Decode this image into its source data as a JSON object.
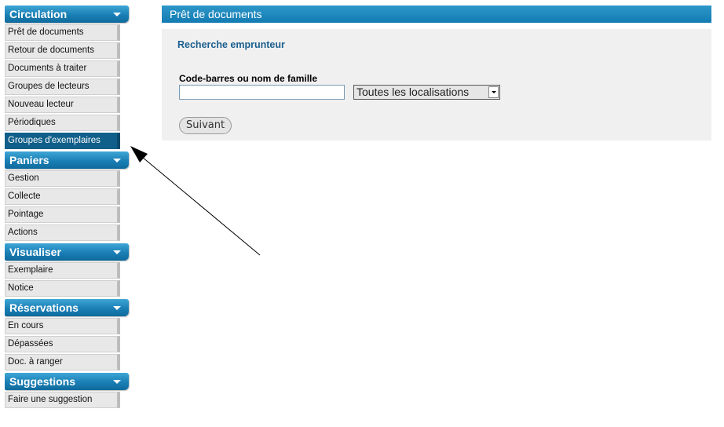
{
  "sidebar": {
    "sections": [
      {
        "title": "Circulation",
        "items": [
          "Prêt de documents",
          "Retour de documents",
          "Documents à traiter",
          "Groupes de lecteurs",
          "Nouveau lecteur",
          "Périodiques",
          "Groupes d'exemplaires"
        ]
      },
      {
        "title": "Paniers",
        "items": [
          "Gestion",
          "Collecte",
          "Pointage",
          "Actions"
        ]
      },
      {
        "title": "Visualiser",
        "items": [
          "Exemplaire",
          "Notice"
        ]
      },
      {
        "title": "Réservations",
        "items": [
          "En cours",
          "Dépassées",
          "Doc. à ranger"
        ]
      },
      {
        "title": "Suggestions",
        "items": [
          "Faire une suggestion"
        ]
      }
    ]
  },
  "main": {
    "title": "Prêt de documents",
    "form": {
      "heading": "Recherche emprunteur",
      "field_label": "Code-barres ou nom de famille",
      "input_value": "",
      "location_selected": "Toutes les localisations",
      "next_label": "Suivant"
    }
  },
  "colors": {
    "header_blue": "#1a7fb5",
    "active_item": "#0f5f8a",
    "heading_text": "#1b5f8e",
    "panel_bg": "#f0f0f0"
  }
}
